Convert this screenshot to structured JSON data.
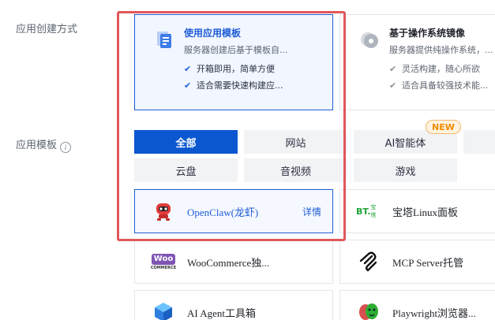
{
  "labels": {
    "creation_method": "应用创建方式",
    "app_template": "应用模板"
  },
  "methods": [
    {
      "title": "使用应用模板",
      "desc": "服务器创建后基于模板自...",
      "features": [
        "开箱即用，简单方便",
        "适合需要快速构建应..."
      ],
      "icon": "template-icon",
      "selected": true
    },
    {
      "title": "基于操作系统镜像",
      "desc": "服务器提供纯操作系统，...",
      "features": [
        "灵活构建，随心所欲",
        "适合具备较强技术能..."
      ],
      "icon": "disk-image-icon",
      "selected": false
    }
  ],
  "filters": {
    "tabs": [
      "全部",
      "网站",
      "AI智能体",
      "云盘",
      "音视频",
      "游戏"
    ],
    "active": "全部",
    "new_badge": "NEW"
  },
  "templates": [
    {
      "name": "OpenClaw(龙虾)",
      "icon": "openclaw-robot-icon",
      "detail": "详情",
      "selected": true
    },
    {
      "name": "宝塔Linux面板",
      "icon": "bt-panel-logo",
      "logo_text": "BT.",
      "selected": false
    },
    {
      "name": "WooCommerce独...",
      "icon": "woocommerce-logo",
      "logo_text": "Woo",
      "logo_sub": "COMMERCE",
      "selected": false
    },
    {
      "name": "MCP Server托管",
      "icon": "mcp-logo",
      "selected": false
    },
    {
      "name": "AI Agent工具箱",
      "icon": "ai-agent-cube-icon",
      "selected": false
    },
    {
      "name": "Playwright浏览器...",
      "icon": "playwright-masks-icon",
      "selected": false
    }
  ],
  "colors": {
    "accent": "#1f5dd6",
    "active_tab": "#0b57d0",
    "highlight_box": "#e0575a",
    "badge": "#f08c00"
  }
}
